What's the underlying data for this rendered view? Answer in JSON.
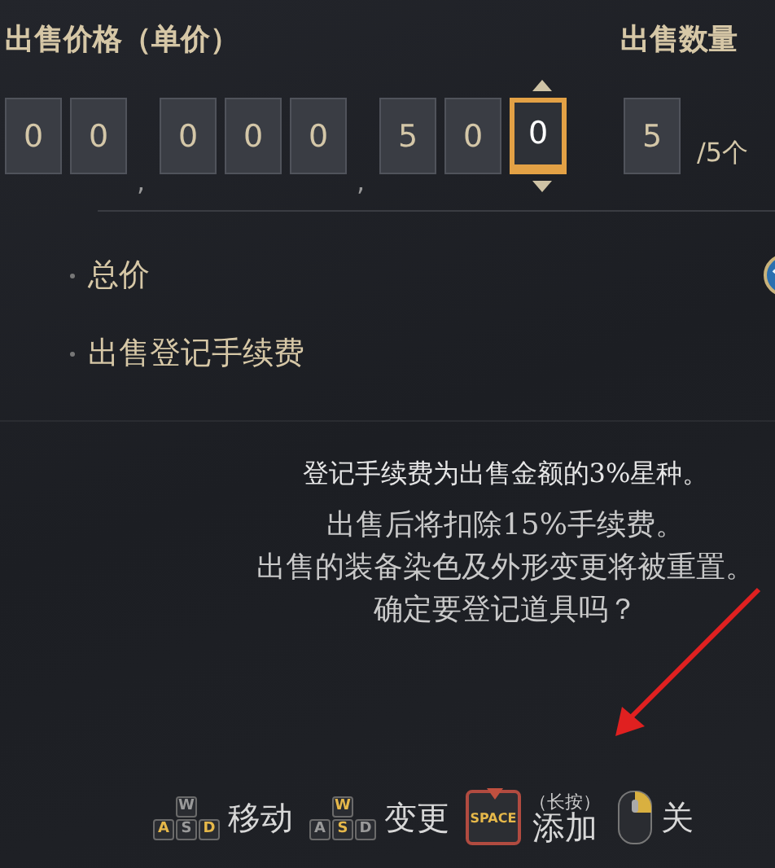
{
  "price": {
    "label": "出售价格（单价）",
    "cells": [
      {
        "kind": "digit",
        "value": "0",
        "selected": false
      },
      {
        "kind": "digit",
        "value": "0",
        "selected": false
      },
      {
        "kind": "separator",
        "value": ","
      },
      {
        "kind": "digit",
        "value": "0",
        "selected": false
      },
      {
        "kind": "digit",
        "value": "0",
        "selected": false
      },
      {
        "kind": "digit",
        "value": "0",
        "selected": false
      },
      {
        "kind": "separator",
        "value": ","
      },
      {
        "kind": "digit",
        "value": "5",
        "selected": false
      },
      {
        "kind": "digit",
        "value": "0",
        "selected": false
      },
      {
        "kind": "digit",
        "value": "0",
        "selected": true
      }
    ]
  },
  "quantity": {
    "label": "出售数量",
    "value": "5",
    "max": "/5个"
  },
  "summary": [
    {
      "label": "总价",
      "currency_icon": true
    },
    {
      "label": "出售登记手续费",
      "currency_icon": false
    }
  ],
  "message": [
    "登记手续费为出售金额的3%星种。",
    "出售后将扣除15%手续费。",
    "出售的装备染色及外形变更将被重置。",
    "确定要登记道具吗？"
  ],
  "hints": [
    {
      "kind": "wasd",
      "keys": [
        {
          "label": "W",
          "highlighted": false
        },
        {
          "label": "A",
          "highlighted": true
        },
        {
          "label": "S",
          "highlighted": false
        },
        {
          "label": "D",
          "highlighted": true
        }
      ],
      "label": "移动"
    },
    {
      "kind": "wasd",
      "keys": [
        {
          "label": "W",
          "highlighted": true
        },
        {
          "label": "A",
          "highlighted": false
        },
        {
          "label": "S",
          "highlighted": true
        },
        {
          "label": "D",
          "highlighted": false
        }
      ],
      "label": "变更"
    },
    {
      "kind": "space",
      "key": "SPACE",
      "note": "（长按）",
      "label": "添加"
    },
    {
      "kind": "mouse",
      "label": "关"
    }
  ]
}
